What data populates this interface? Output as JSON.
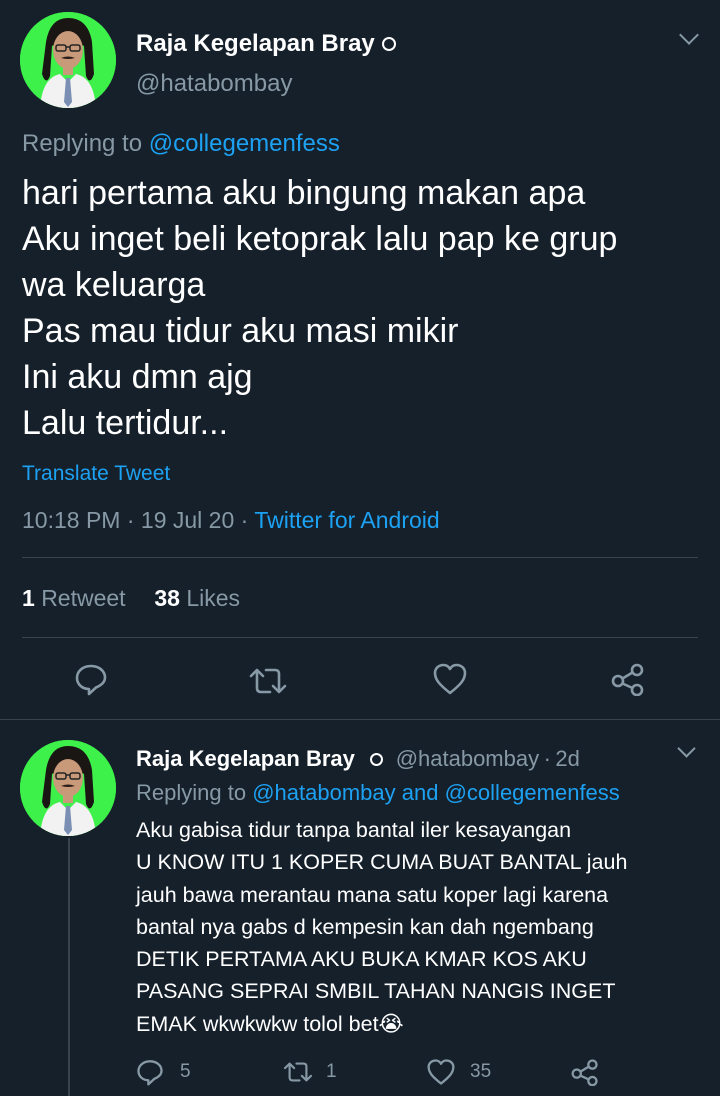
{
  "main_tweet": {
    "display_name": "Raja Kegelapan Bray",
    "handle": "@hatabombay",
    "replying_prefix": "Replying to",
    "replying_to": "@collegemenfess",
    "lines": [
      "hari pertama aku bingung makan apa",
      "Aku inget beli ketoprak lalu pap ke grup",
      "wa keluarga",
      "Pas mau tidur aku masi mikir",
      "Ini aku dmn ajg",
      "Lalu tertidur..."
    ],
    "translate_label": "Translate Tweet",
    "time": "10:18 PM",
    "date": "19 Jul 20",
    "source": "Twitter for Android",
    "separator": "·",
    "retweet_count": "1",
    "retweet_label": "Retweet",
    "like_count": "38",
    "like_label": "Likes"
  },
  "actions": {
    "reply_icon": "reply-icon",
    "retweet_icon": "retweet-icon",
    "like_icon": "heart-icon",
    "share_icon": "share-icon"
  },
  "reply_tweet": {
    "display_name": "Raja Kegelapan Bray",
    "handle": "@hatabombay",
    "separator": "·",
    "age": "2d",
    "replying_prefix": "Replying to",
    "replying_to_1": "@hatabombay",
    "replying_and": "and",
    "replying_to_2": "@collegemenfess",
    "lines": [
      "Aku gabisa tidur tanpa bantal iler kesayangan",
      "U KNOW ITU 1 KOPER CUMA BUAT BANTAL jauh",
      "jauh bawa merantau mana satu koper lagi karena",
      "bantal nya gabs d kempesin kan dah ngembang",
      "DETIK PERTAMA AKU BUKA KMAR KOS AKU",
      "PASANG SEPRAI SMBIL TAHAN NANGIS INGET",
      "EMAK wkwkwkw tolol bet😭"
    ],
    "reply_count": "5",
    "retweet_count": "1",
    "like_count": "35"
  },
  "colors": {
    "background": "#15202b",
    "secondary_text": "#8899a6",
    "link": "#1da1f2",
    "divider": "#38444d",
    "avatar_bg": "#3df04a"
  }
}
